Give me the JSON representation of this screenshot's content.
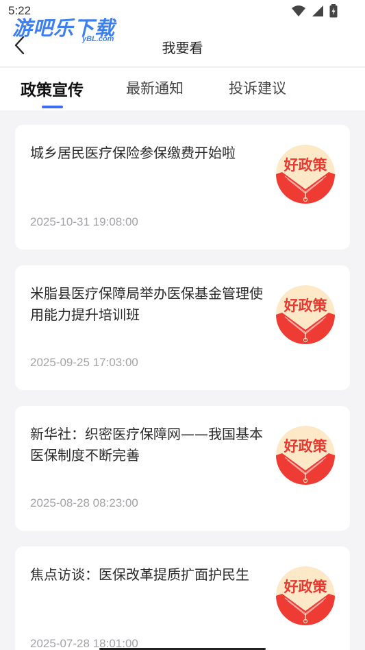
{
  "status_bar": {
    "time": "5:22"
  },
  "watermark": {
    "text": "游吧乐下载",
    "sub": "yBL.com"
  },
  "header": {
    "title": "我要看"
  },
  "tabs": [
    {
      "label": "政策宣传",
      "active": true
    },
    {
      "label": "最新通知",
      "active": false
    },
    {
      "label": "投诉建议",
      "active": false
    }
  ],
  "articles": [
    {
      "title": "城乡居民医疗保险参保缴费开始啦",
      "date": "2025-10-31 19:08:00",
      "badge": "好政策"
    },
    {
      "title": "米脂县医疗保障局举办医保基金管理使用能力提升培训班",
      "date": "2025-09-25 17:03:00",
      "badge": "好政策"
    },
    {
      "title": "新华社：织密医疗保障网——我国基本医保制度不断完善",
      "date": "2025-08-28 08:23:00",
      "badge": "好政策"
    },
    {
      "title": "焦点访谈：医保改革提质扩面护民生",
      "date": "2025-07-28 18:01:00",
      "badge": "好政策"
    }
  ],
  "colors": {
    "accent": "#3d6df2",
    "badge_red": "#e8382f",
    "badge_bg": "#fde9c8",
    "page_bg": "#f4f4f6"
  }
}
